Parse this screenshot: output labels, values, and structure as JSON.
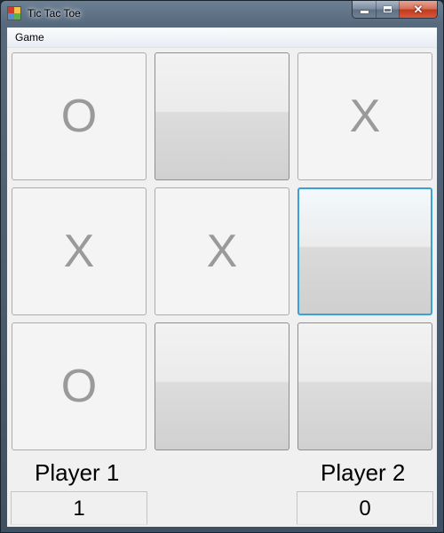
{
  "window": {
    "title": "Tic Tac Toe",
    "close_glyph": "✕"
  },
  "menu": {
    "items": [
      "Game"
    ]
  },
  "board": {
    "cells": [
      [
        "O",
        "",
        "X"
      ],
      [
        "X",
        "X",
        ""
      ],
      [
        "O",
        "",
        ""
      ]
    ],
    "focused_cell": "1,2"
  },
  "players": [
    {
      "label": "Player 1",
      "score": "1"
    },
    {
      "label": "Player 2",
      "score": "0"
    }
  ],
  "colors": {
    "mark": "#9a9a9a",
    "focus_border": "#3c9fd8"
  }
}
